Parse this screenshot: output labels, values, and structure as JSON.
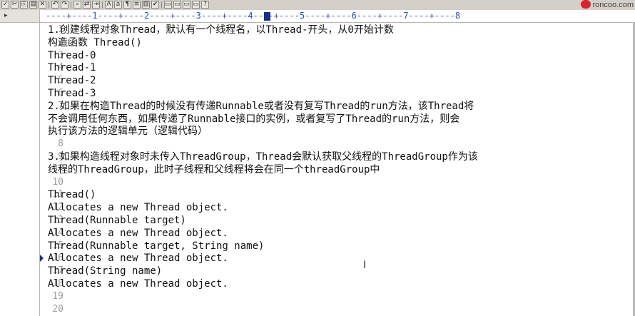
{
  "toolbar": {
    "brand_label": "roncoo.com",
    "buttons": [
      "check-icon",
      "cut-icon",
      "copy-icon",
      "paste-icon",
      "delete-icon",
      "undo-icon",
      "redo-icon",
      "find-icon",
      "replace-icon",
      "goto-icon",
      "font-icon",
      "case-icon",
      "wrap-icon",
      "list-icon",
      "column-icon",
      "spell-icon",
      "window1-icon",
      "window2-icon",
      "window3-icon",
      "window4-icon",
      "help-icon"
    ]
  },
  "ruler": {
    "text": "----+----1----+----2----+----3----+----4----+----5----+----6----+----7----+----8"
  },
  "lines": [
    {
      "n": "1",
      "text": "1.创建线程对象Thread，默认有一个线程名，以Thread-开头，从0开始计数"
    },
    {
      "n": "2",
      "text": "构造函数 Thread()"
    },
    {
      "n": "3",
      "text": "Thread-0"
    },
    {
      "n": "4",
      "text": "Thread-1"
    },
    {
      "n": "5",
      "text": "Thread-2"
    },
    {
      "n": "6",
      "text": "Thread-3"
    },
    {
      "n": "7",
      "text": "2.如果在构造Thread的时候没有传递Runnable或者没有复写Thread的run方法，该Thread将"
    },
    {
      "n": "",
      "text": "不会调用任何东西，如果传递了Runnable接口的实例，或者复写了Thread的run方法，则会"
    },
    {
      "n": "",
      "text": "执行该方法的逻辑单元（逻辑代码）"
    },
    {
      "n": "8",
      "text": ""
    },
    {
      "n": "9",
      "text": "3.如果构造线程对象时未传入ThreadGroup，Thread会默认获取父线程的ThreadGroup作为该"
    },
    {
      "n": "",
      "text": "线程的ThreadGroup，此时子线程和父线程将会在同一个threadGroup中"
    },
    {
      "n": "10",
      "text": ""
    },
    {
      "n": "11",
      "text": "Thread()"
    },
    {
      "n": "12",
      "text": "Allocates a new Thread object."
    },
    {
      "n": "13",
      "text": "Thread(Runnable target)"
    },
    {
      "n": "14",
      "text": "Allocates a new Thread object."
    },
    {
      "n": "15",
      "text": "Thread(Runnable target, String name)"
    },
    {
      "n": "16",
      "text": "Allocates a new Thread object."
    },
    {
      "n": "17",
      "text": "Thread(String name)"
    },
    {
      "n": "18",
      "text": "Allocates a new Thread object."
    },
    {
      "n": "19",
      "text": ""
    },
    {
      "n": "20",
      "text": ""
    }
  ],
  "current_line": "16"
}
